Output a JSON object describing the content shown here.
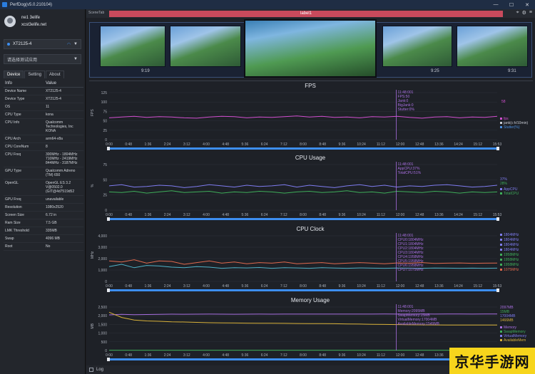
{
  "window": {
    "title": "PerfDog(v5.0.210104)"
  },
  "user": {
    "name": "ne1 3elife",
    "email": "xcst3elife.net"
  },
  "device_select": {
    "value": "XT2125-4"
  },
  "app_select": {
    "value": "请选择测试应用"
  },
  "tabs": [
    {
      "label": "Device"
    },
    {
      "label": "Setting"
    },
    {
      "label": "About"
    }
  ],
  "info": {
    "header": {
      "key": "Info",
      "value": "Value"
    },
    "rows": [
      {
        "k": "Device Name",
        "v": "XT2125-4"
      },
      {
        "k": "Device Type",
        "v": "XT2125-4"
      },
      {
        "k": "OS",
        "v": "11"
      },
      {
        "k": "CPU Type",
        "v": "kona"
      },
      {
        "k": "CPU Info",
        "v": "Qualcomm Technologies, Inc KONA"
      },
      {
        "k": "CPU Arch",
        "v": "arm64-v8a"
      },
      {
        "k": "CPU CoreNum",
        "v": "8"
      },
      {
        "k": "CPU Freq",
        "v": "300MHz - 1804MHz 710MHz - 2419MHz 844MHz - 3187MHz"
      },
      {
        "k": "GPU Type",
        "v": "Qualcomm Adreno (TM) 650"
      },
      {
        "k": "OpenGL",
        "v": "OpenGL ES 3.2 V@0502.0 (GIT@4d7519d52"
      },
      {
        "k": "GPU Freq",
        "v": "unavailable"
      },
      {
        "k": "Resolution",
        "v": "1080x2520"
      },
      {
        "k": "Screen Size",
        "v": "6.72 in"
      },
      {
        "k": "Ram Size",
        "v": "7.5 GB"
      },
      {
        "k": "LMK Threshold",
        "v": "335MB"
      },
      {
        "k": "Swap",
        "v": "4096 MB"
      },
      {
        "k": "Root",
        "v": "No"
      }
    ]
  },
  "scene": {
    "label": "SceneTab",
    "bar_label": "label1"
  },
  "thumbnails": {
    "times": [
      "9:19",
      "",
      "",
      "9:25",
      "9:31"
    ]
  },
  "log": {
    "label": "Log"
  },
  "watermark": {
    "text": "京华手游网"
  },
  "colors": {
    "fps": "#d24fd0",
    "cpu_app": "#7f7cf0",
    "cpu_total": "#3fae5a",
    "cursor": "#a86fe0",
    "progress": "#3d8ef0"
  },
  "chart_data": [
    {
      "type": "line",
      "title": "FPS",
      "ylabel": "FPS",
      "yticks": [
        "125",
        "100",
        "75",
        "50",
        "25",
        "0"
      ],
      "ylim": [
        0,
        125
      ],
      "xticks": [
        "0:00",
        "0:48",
        "1:36",
        "2:24",
        "3:12",
        "4:00",
        "4:48",
        "5:36",
        "6:24",
        "7:12",
        "8:00",
        "8:48",
        "9:36",
        "10:24",
        "11:12",
        "12:00",
        "12:48",
        "13:36",
        "14:24",
        "15:12",
        "15:53"
      ],
      "cursor": {
        "time": "11:48:001",
        "lines": [
          "FPS:50",
          "Jank:0",
          "BigJank:0",
          "Stutter:0%"
        ]
      },
      "series": [
        {
          "name": "FPS",
          "values": [
            58,
            60,
            62,
            59,
            61,
            60,
            58,
            57,
            60,
            62,
            61,
            58,
            60,
            59,
            61,
            63,
            60,
            62,
            59,
            60,
            58,
            61,
            60,
            62,
            59,
            57,
            60,
            61,
            58,
            60,
            59,
            62
          ]
        }
      ],
      "legend": [
        "fps",
        "jank(c:h/10min)",
        "Stutter(%)"
      ],
      "current_value": "58"
    },
    {
      "type": "line",
      "title": "CPU Usage",
      "ylabel": "%",
      "yticks": [
        "75",
        "50",
        "25",
        "0"
      ],
      "ylim": [
        0,
        75
      ],
      "xticks": [
        "0:00",
        "0:48",
        "1:36",
        "2:24",
        "3:12",
        "4:00",
        "4:48",
        "5:36",
        "6:24",
        "7:12",
        "8:00",
        "8:48",
        "9:36",
        "10:24",
        "11:12",
        "12:00",
        "12:48",
        "13:36",
        "14:24",
        "15:12",
        "15:53"
      ],
      "cursor": {
        "time": "11:48:001",
        "lines": [
          "AppCPU:37%",
          "TotalCPU:51%"
        ]
      },
      "series": [
        {
          "name": "AppCPU",
          "values": [
            40,
            42,
            38,
            39,
            41,
            40,
            37,
            39,
            42,
            40,
            38,
            41,
            39,
            40,
            42,
            38,
            41,
            39,
            37,
            40,
            42,
            39,
            41,
            38,
            40,
            39,
            41,
            42,
            40,
            38,
            39,
            41
          ]
        },
        {
          "name": "TotalCPU",
          "values": [
            30,
            29,
            31,
            28,
            30,
            32,
            29,
            30,
            31,
            28,
            30,
            29,
            31,
            30,
            28,
            30,
            31,
            29,
            30,
            32,
            29,
            30,
            28,
            31,
            30,
            29,
            31,
            30,
            28,
            30,
            29,
            30
          ]
        }
      ],
      "legend": [
        "AppCPU",
        "TotalCPU"
      ],
      "current_values": [
        "37%",
        "28%"
      ]
    },
    {
      "type": "line",
      "title": "CPU Clock",
      "ylabel": "MHz",
      "yticks": [
        "4,000",
        "3,000",
        "2,000",
        "1,000",
        "0"
      ],
      "ylim": [
        0,
        4000
      ],
      "xticks": [
        "0:00",
        "0:48",
        "1:36",
        "2:24",
        "3:12",
        "4:00",
        "4:48",
        "5:36",
        "6:24",
        "7:12",
        "8:00",
        "8:48",
        "9:36",
        "10:24",
        "11:12",
        "12:00",
        "12:48",
        "13:36",
        "14:24",
        "15:12",
        "15:53"
      ],
      "cursor": {
        "time": "11:48:001",
        "lines": [
          "CPU0:1804MHz",
          "CPU1:1804MHz",
          "CPU2:1804MHz",
          "CPU3:1804MHz",
          "CPU4:1958MHz",
          "CPU5:1958MHz",
          "CPU6:1958MHz",
          "CPU7:1075MHz"
        ]
      },
      "series": [
        {
          "name": "CPU0",
          "values": [
            1800,
            1700,
            1900,
            1600,
            1800,
            1750,
            1500,
            1650,
            1800,
            1600,
            1700,
            1550,
            1650,
            1600,
            1700,
            1550,
            1600,
            1650,
            1550,
            1600,
            1650,
            1600,
            1550,
            1620,
            1600,
            1650,
            1580,
            1600,
            1620,
            1590,
            1600,
            1610
          ]
        },
        {
          "name": "CPU7",
          "values": [
            1300,
            1500,
            1200,
            1400,
            1350,
            1250,
            1200,
            1300,
            1250,
            1150,
            1200,
            1180,
            1220,
            1150,
            1200,
            1180,
            1150,
            1200,
            1170,
            1150,
            1180,
            1160,
            1150,
            1170,
            1160,
            1150,
            1170,
            1160,
            1150,
            1160,
            1150,
            1160
          ]
        }
      ],
      "legend_values": [
        "1804MHz",
        "1804MHz",
        "1804MHz",
        "1804MHz",
        "1958MHz",
        "1958MHz",
        "1958MHz",
        "1075MHz"
      ]
    },
    {
      "type": "line",
      "title": "Memory Usage",
      "ylabel": "MB",
      "yticks": [
        "2,500",
        "2,000",
        "1,500",
        "1,000",
        "500",
        "0"
      ],
      "ylim": [
        0,
        2500
      ],
      "xticks": [
        "0:00",
        "0:48",
        "1:36",
        "2:24",
        "3:12",
        "4:00",
        "4:48",
        "5:36",
        "6:24",
        "7:12",
        "8:00",
        "8:48",
        "9:36",
        "10:24",
        "11:12",
        "12:00",
        "12:48",
        "13:36",
        "14:24",
        "15:12",
        "15:53"
      ],
      "cursor": {
        "time": "11:48:001",
        "lines": [
          "Memory:2095MB",
          "SwapMemory:15MB",
          "VirtualMemory:17004MB",
          "AvailableMemory:1549MB"
        ]
      },
      "series": [
        {
          "name": "Memory",
          "values": [
            2050,
            2080,
            2060,
            2070,
            2080,
            2090,
            2085,
            2090,
            2095,
            2090,
            2088,
            2092,
            2095,
            2090,
            2093,
            2095,
            2094,
            2096,
            2095,
            2095,
            2096,
            2095,
            2097,
            2095,
            2096,
            2097,
            2096,
            2097,
            2097,
            2096,
            2097,
            2097
          ]
        },
        {
          "name": "SwapMemory",
          "values": [
            15,
            15,
            15,
            15,
            15,
            15,
            15,
            15,
            15,
            15,
            15,
            15,
            15,
            15,
            15,
            15,
            15,
            15,
            15,
            15,
            15,
            15,
            15,
            15,
            15,
            15,
            15,
            15,
            15,
            15,
            15,
            15
          ]
        },
        {
          "name": "AvailableMemory",
          "values": [
            2200,
            1900,
            1750,
            1700,
            1680,
            1650,
            1640,
            1620,
            1600,
            1590,
            1580,
            1575,
            1570,
            1565,
            1560,
            1555,
            1550,
            1549,
            1540,
            1530,
            1520,
            1510,
            1500,
            1490,
            1480,
            1475,
            1470,
            1468,
            1466,
            1466,
            1466,
            1466
          ]
        }
      ],
      "legend": [
        "Memory",
        "SwapMemory",
        "VirtualMemory",
        "AvailableMem"
      ],
      "current_values": [
        "2097MB",
        "15MB",
        "17004MB",
        "1466MB"
      ]
    }
  ]
}
